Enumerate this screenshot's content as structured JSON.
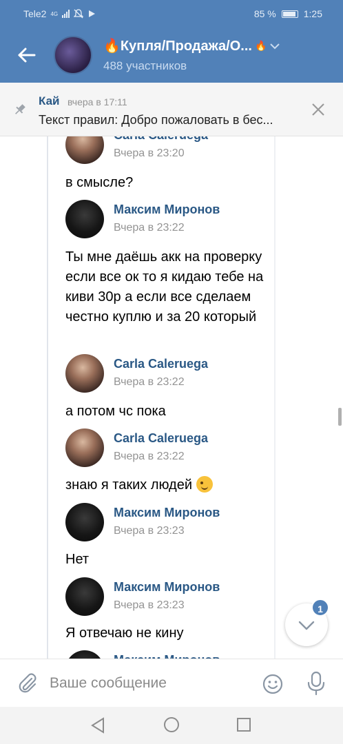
{
  "status_bar": {
    "carrier": "Tele2",
    "network": "4G",
    "battery": "85 %",
    "time": "1:25"
  },
  "header": {
    "title": "🔥Купля/Продажа/О...",
    "flame_end": "🔥",
    "members": "488 участников"
  },
  "pinned": {
    "author": "Кай",
    "time": "вчера в 17:11",
    "text": "Текст правил: Добро пожаловать в бес..."
  },
  "messages": [
    {
      "author": "Carla Caleruega",
      "time": "Вчера в 23:20",
      "text": "в смысле?"
    },
    {
      "author": "Максим Миронов",
      "time": "Вчера в 23:22",
      "text": "Ты мне даёшь акк на проверку если все ок то я кидаю тебе на киви 30р а если все сделаем честно куплю и за 20 который"
    },
    {
      "author": "Carla Caleruega",
      "time": "Вчера в 23:22",
      "text": "а потом чс пока"
    },
    {
      "author": "Carla Caleruega",
      "time": "Вчера в 23:22",
      "text": "знаю я таких людей"
    },
    {
      "author": "Максим Миронов",
      "time": "Вчера в 23:23",
      "text": "Нет"
    },
    {
      "author": "Максим Миронов",
      "time": "Вчера в 23:23",
      "text": "Я отвечаю не кину"
    },
    {
      "author": "Максим Миронов"
    }
  ],
  "scroll_down": {
    "badge": "1"
  },
  "composer": {
    "placeholder": "Ваше сообщение"
  },
  "icons": {
    "back": "arrow-left-icon",
    "pin": "pin-icon",
    "close": "close-icon",
    "attach": "paperclip-icon",
    "emoji": "smile-icon",
    "mic": "microphone-icon",
    "scroll": "chevron-down-icon",
    "wink": "wink-emoji"
  },
  "colors": {
    "brand": "#5181b8",
    "link": "#2a5885",
    "muted": "#939393"
  }
}
